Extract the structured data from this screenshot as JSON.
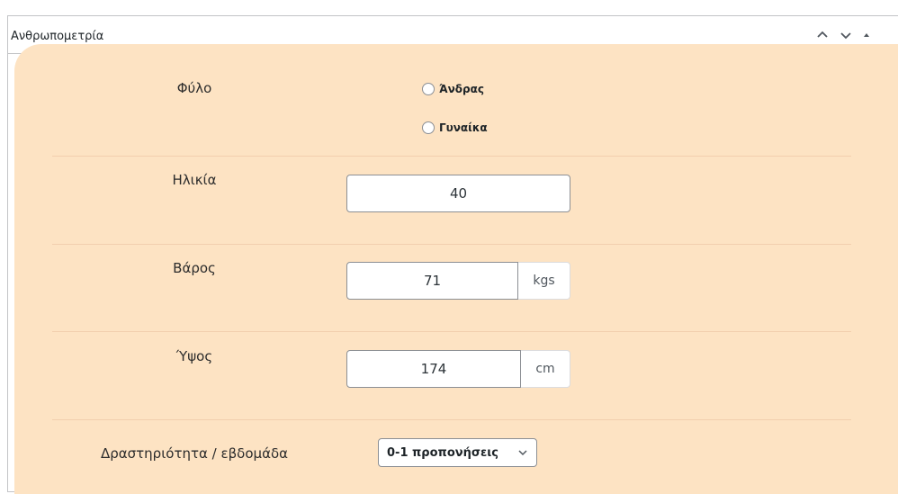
{
  "panel": {
    "title": "Ανθρωπομετρία",
    "icons": [
      "chevron-up-icon",
      "chevron-down-icon",
      "triangle-up-icon"
    ]
  },
  "form": {
    "gender": {
      "label": "Φύλο",
      "options": [
        "Άνδρας",
        "Γυναίκα"
      ]
    },
    "age": {
      "label": "Ηλικία",
      "value": "40"
    },
    "weight": {
      "label": "Βάρος",
      "value": "71",
      "unit": "kgs"
    },
    "height": {
      "label": "Ύψος",
      "value": "174",
      "unit": "cm"
    },
    "activity": {
      "label": "Δραστηριότητα / εβδομάδα",
      "selected": "0-1 προπονήσεις"
    }
  },
  "colors": {
    "content_bg": "#fde3c3",
    "separator": "#f2cfae",
    "border": "#c3c4c7"
  }
}
